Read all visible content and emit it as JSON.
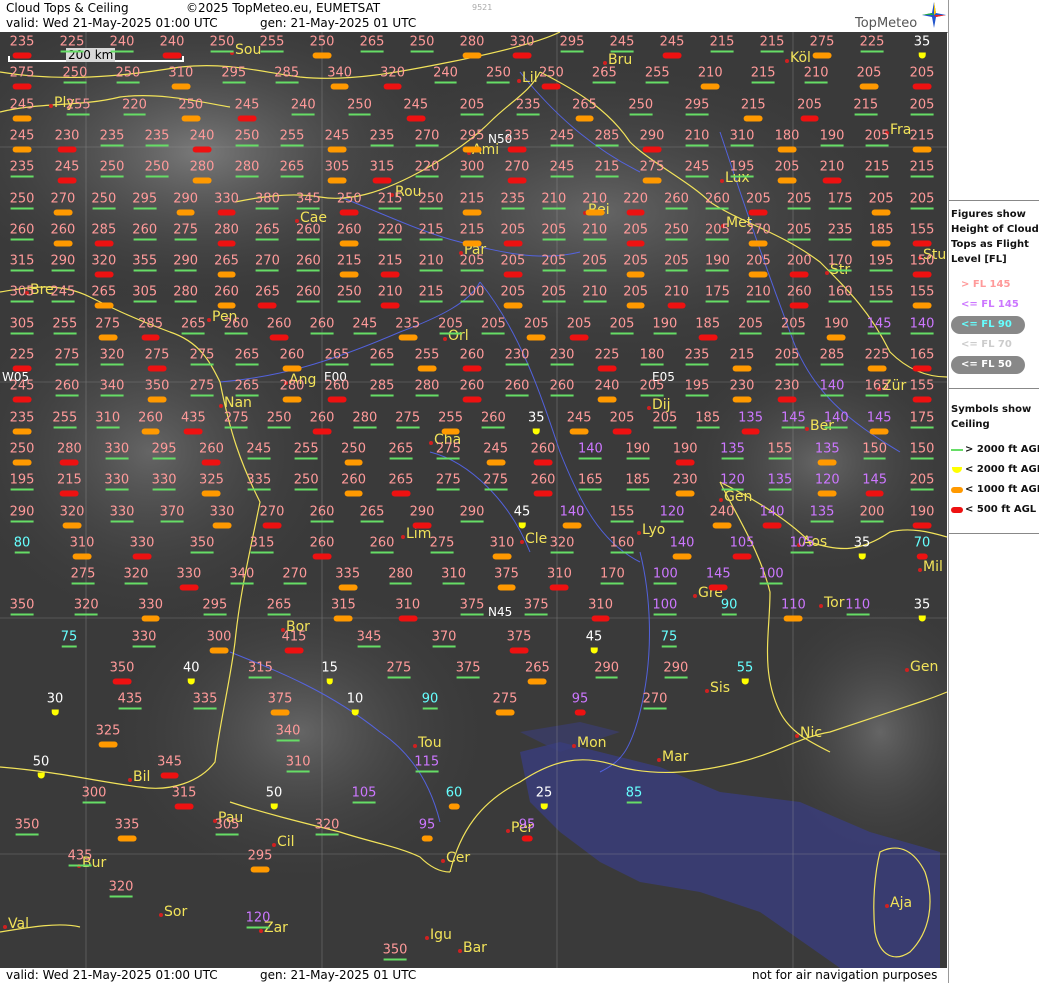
{
  "header": {
    "title": "Cloud Tops & Ceiling",
    "copyright": "©2025 TopMeteo.eu, EUMETSAT",
    "valid": "valid:  Wed  21-May-2025  01:00 UTC",
    "gen": "gen: 21-May-2025 01 UTC",
    "code": "9521",
    "logo": "TopMeteo"
  },
  "footer": {
    "valid": "valid:  Wed  21-May-2025  01:00 UTC",
    "gen": "gen: 21-May-2025 01 UTC",
    "disclaimer": "not for air navigation purposes"
  },
  "scale_bar": "200 km",
  "legend": {
    "figures_title": "Figures show\nHeight of Cloud\nTops as Flight\nLevel  [FL]",
    "figures": [
      {
        "label": "> FL 145",
        "color": "#ff9a9a",
        "bg": "none"
      },
      {
        "label": "<= FL 145",
        "color": "#cc77ff",
        "bg": "none"
      },
      {
        "label": "<= FL 90",
        "color": "#66ffff",
        "bg": "#888888"
      },
      {
        "label": "<= FL 70",
        "color": "#cccccc",
        "bg": "none"
      },
      {
        "label": "<= FL 50",
        "color": "#ffffff",
        "bg": "#888888"
      }
    ],
    "symbols_title": "Symbols show\nCeiling",
    "symbols": [
      {
        "label": "> 2000 ft AGL",
        "type": "line",
        "color": "#66dd66"
      },
      {
        "label": "< 2000 ft AGL",
        "type": "half",
        "color": "#ffff00"
      },
      {
        "label": "< 1000 ft AGL",
        "type": "bar",
        "color": "#ff9900"
      },
      {
        "label": "< 500 ft AGL",
        "type": "bar",
        "color": "#ee1111"
      }
    ]
  },
  "colors": {
    "high": "#ff9a9a",
    "mid": "#cc77ff",
    "low": "#66ffff",
    "vlow": "#ffffff",
    "ceil_ok": "#66dd66",
    "ceil_2000": "#ffff00",
    "ceil_1000": "#ff9900",
    "ceil_500": "#ee1111",
    "border": "#f2e35a",
    "river": "#5566ee"
  },
  "coordinates": [
    "N50",
    "E00",
    "W05",
    "E05",
    "N45"
  ],
  "cities": [
    "Sou",
    "Bru",
    "Köl",
    "Lil",
    "Ply",
    "Fra",
    "Ami",
    "Lux",
    "Rou",
    "Cae",
    "Rei",
    "Met",
    "Par",
    "Str",
    "Stu",
    "Bre",
    "Pen",
    "Orl",
    "Ang",
    "Nan",
    "Dij",
    "Zür",
    "Ber",
    "Cha",
    "Gen",
    "Lim",
    "Cle",
    "Lyo",
    "Aos",
    "Mil",
    "Gre",
    "Tor",
    "Bor",
    "Sis",
    "Gen",
    "Tou",
    "Nic",
    "Mon",
    "Mar",
    "Bil",
    "Pau",
    "Per",
    "Cil",
    "Bur",
    "Cer",
    "Sor",
    "Val",
    "Zar",
    "Aja",
    "Igu",
    "Bar"
  ],
  "flight_levels": [
    [
      "235",
      "225",
      "240",
      "240",
      "250",
      "255",
      "250",
      "265",
      "250",
      "280",
      "330",
      "295",
      "245",
      "245",
      "215",
      "215",
      "275",
      "225",
      "35"
    ],
    [
      "275",
      "250",
      "250",
      "310",
      "295",
      "285",
      "340",
      "320",
      "240",
      "250",
      "250",
      "265",
      "255",
      "210",
      "215",
      "210",
      "205",
      "205"
    ],
    [
      "245",
      "255",
      "220",
      "250",
      "245",
      "240",
      "250",
      "245",
      "205",
      "235",
      "265",
      "250",
      "295",
      "215",
      "205",
      "215",
      "205"
    ],
    [
      "245",
      "230",
      "235",
      "235",
      "240",
      "250",
      "255",
      "245",
      "235",
      "270",
      "295",
      "235",
      "245",
      "285",
      "290",
      "210",
      "310",
      "180",
      "190",
      "205",
      "215"
    ],
    [
      "235",
      "245",
      "250",
      "250",
      "280",
      "280",
      "265",
      "305",
      "315",
      "220",
      "300",
      "270",
      "245",
      "215",
      "275",
      "245",
      "195",
      "205",
      "210",
      "215",
      "215"
    ],
    [
      "250",
      "270",
      "250",
      "295",
      "290",
      "330",
      "380",
      "345",
      "250",
      "215",
      "250",
      "215",
      "235",
      "210",
      "210",
      "220",
      "260",
      "260",
      "205",
      "205",
      "175",
      "205",
      "205"
    ],
    [
      "260",
      "260",
      "285",
      "260",
      "275",
      "280",
      "265",
      "260",
      "260",
      "220",
      "215",
      "215",
      "205",
      "205",
      "210",
      "205",
      "250",
      "205",
      "270",
      "205",
      "235",
      "185",
      "155"
    ],
    [
      "315",
      "290",
      "320",
      "355",
      "290",
      "265",
      "270",
      "260",
      "215",
      "215",
      "210",
      "205",
      "205",
      "205",
      "205",
      "205",
      "205",
      "190",
      "205",
      "200",
      "170",
      "195",
      "150"
    ],
    [
      "305",
      "245",
      "265",
      "305",
      "280",
      "260",
      "265",
      "260",
      "250",
      "210",
      "215",
      "200",
      "205",
      "205",
      "210",
      "205",
      "210",
      "175",
      "210",
      "260",
      "160",
      "155",
      "155"
    ],
    [
      "305",
      "255",
      "275",
      "285",
      "265",
      "260",
      "260",
      "260",
      "245",
      "235",
      "205",
      "205",
      "205",
      "205",
      "205",
      "190",
      "185",
      "205",
      "205",
      "190",
      "145",
      "140"
    ],
    [
      "225",
      "275",
      "320",
      "275",
      "275",
      "265",
      "260",
      "265",
      "265",
      "255",
      "260",
      "230",
      "230",
      "225",
      "180",
      "235",
      "215",
      "205",
      "285",
      "225",
      "165"
    ],
    [
      "245",
      "260",
      "340",
      "350",
      "275",
      "265",
      "280",
      "260",
      "285",
      "280",
      "260",
      "260",
      "260",
      "240",
      "205",
      "195",
      "230",
      "230",
      "140",
      "165",
      "155"
    ],
    [
      "235",
      "255",
      "310",
      "260",
      "435",
      "275",
      "250",
      "260",
      "280",
      "275",
      "255",
      "260",
      "35",
      "245",
      "205",
      "205",
      "185",
      "135",
      "145",
      "140",
      "145",
      "175"
    ],
    [
      "250",
      "280",
      "330",
      "295",
      "260",
      "245",
      "255",
      "250",
      "265",
      "275",
      "245",
      "260",
      "140",
      "190",
      "190",
      "135",
      "155",
      "135",
      "150",
      "150"
    ],
    [
      "195",
      "215",
      "330",
      "330",
      "325",
      "335",
      "250",
      "260",
      "265",
      "275",
      "275",
      "260",
      "165",
      "185",
      "230",
      "120",
      "135",
      "120",
      "145",
      "205"
    ],
    [
      "290",
      "320",
      "330",
      "370",
      "330",
      "270",
      "260",
      "265",
      "290",
      "290",
      "45",
      "140",
      "155",
      "120",
      "240",
      "140",
      "135",
      "200",
      "190"
    ],
    [
      "80",
      "310",
      "330",
      "350",
      "315",
      "260",
      "260",
      "275",
      "310",
      "320",
      "160",
      "140",
      "105",
      "105",
      "35",
      "70"
    ],
    [
      "275",
      "320",
      "330",
      "340",
      "270",
      "335",
      "280",
      "310",
      "375",
      "310",
      "170",
      "100",
      "145",
      "100"
    ],
    [
      "350",
      "320",
      "330",
      "295",
      "265",
      "315",
      "310",
      "375",
      "375",
      "310",
      "100",
      "90",
      "110",
      "110",
      "35"
    ],
    [
      "75",
      "330",
      "300",
      "415",
      "345",
      "370",
      "375",
      "45",
      "75"
    ],
    [
      "350",
      "40",
      "315",
      "15",
      "275",
      "375",
      "265",
      "290",
      "290",
      "55"
    ],
    [
      "30",
      "435",
      "335",
      "375",
      "10",
      "90",
      "275",
      "95",
      "270"
    ],
    [
      "325",
      "340"
    ],
    [
      "50",
      "345",
      "310",
      "115"
    ],
    [
      "300",
      "315",
      "50",
      "105",
      "60",
      "25",
      "85"
    ],
    [
      "350",
      "335",
      "305",
      "320",
      "95",
      "95"
    ],
    [
      "435",
      "295"
    ],
    [
      "320"
    ],
    [
      "120"
    ],
    [
      "350"
    ]
  ]
}
